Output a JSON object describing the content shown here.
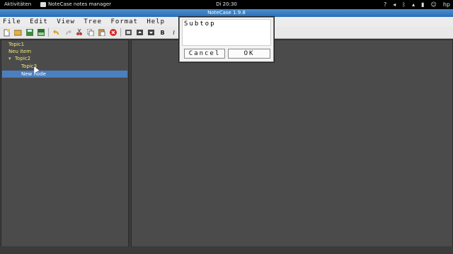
{
  "topbar": {
    "activities": "Aktivitäten",
    "app_name": "NoteCase notes manager",
    "clock": "Di 20:30",
    "user": "hp",
    "tray_icons": [
      "help-icon",
      "volume-icon",
      "bluetooth-icon",
      "network-icon",
      "battery-icon",
      "user-icon"
    ]
  },
  "window": {
    "title": "NoteCase 1.9.8"
  },
  "menu": [
    "File",
    "Edit",
    "View",
    "Tree",
    "Format",
    "Help"
  ],
  "toolbar": {
    "icons": [
      "new-document-icon",
      "open-icon",
      "save-icon",
      "save-as-icon",
      "undo-icon",
      "redo-icon",
      "cut-icon",
      "copy-icon",
      "paste-icon",
      "delete-icon",
      "node-new-icon",
      "node-up-icon",
      "node-down-icon",
      "bold-icon",
      "italic-icon"
    ],
    "bold_label": "B",
    "italic_label": "I"
  },
  "tree": {
    "nodes": [
      {
        "label": "Topic1",
        "level": 0,
        "selected": false
      },
      {
        "label": "Neu item",
        "level": 0,
        "selected": false
      },
      {
        "label": "Topic2",
        "level": 1,
        "selected": false
      },
      {
        "label": "Topic3",
        "level": 2,
        "selected": false
      },
      {
        "label": "New node",
        "level": 2,
        "selected": true
      }
    ]
  },
  "dialog": {
    "input_value": "Subtop",
    "cancel_label": "Cancel",
    "ok_label": "OK"
  },
  "colors": {
    "topbar_bg": "#000000",
    "titlebar": "#2a6db5",
    "tree_text": "#f4e87b",
    "selection": "#4c7fbf",
    "panel_bg": "#4b4b4b"
  }
}
